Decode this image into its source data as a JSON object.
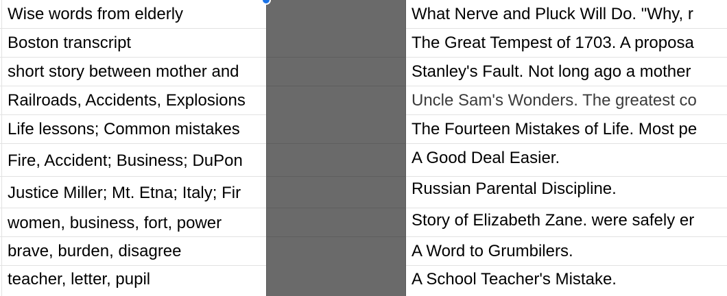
{
  "sheet": {
    "rows": [
      {
        "a": "Wise words from elderly",
        "b": "",
        "c": "What Nerve and Pluck Will Do. \"Why, r",
        "c_dim": false
      },
      {
        "a": "Boston transcript",
        "b": "",
        "c": "The Great Tempest of 1703. A proposa",
        "c_dim": false
      },
      {
        "a": "short story between mother and",
        "b": "",
        "c": "Stanley's Fault. Not long ago a mother",
        "c_dim": false
      },
      {
        "a": "Railroads, Accidents, Explosions",
        "b": "",
        "c": "Uncle Sam's Wonders. The greatest co",
        "c_dim": true
      },
      {
        "a": "Life lessons; Common mistakes",
        "b": "",
        "c": "The Fourteen Mistakes of Life. Most pe",
        "c_dim": false
      },
      {
        "a": "Fire, Accident; Business; DuPon",
        "b": "",
        "c": "A Good Deal Easier.",
        "c_dim": false
      },
      {
        "a": "Justice Miller; Mt. Etna; Italy; Fir",
        "b": "",
        "c": "Russian Parental Discipline.",
        "c_dim": false
      },
      {
        "a": "women, business, fort, power",
        "b": "",
        "c": "Story of Elizabeth Zane. were safely er",
        "c_dim": false
      },
      {
        "a": "brave, burden, disagree",
        "b": "",
        "c": "A Word to Grumbilers.",
        "c_dim": false
      },
      {
        "a": "teacher, letter, pupil",
        "b": "",
        "c": "A School Teacher's Mistake.",
        "c_dim": false
      }
    ]
  }
}
